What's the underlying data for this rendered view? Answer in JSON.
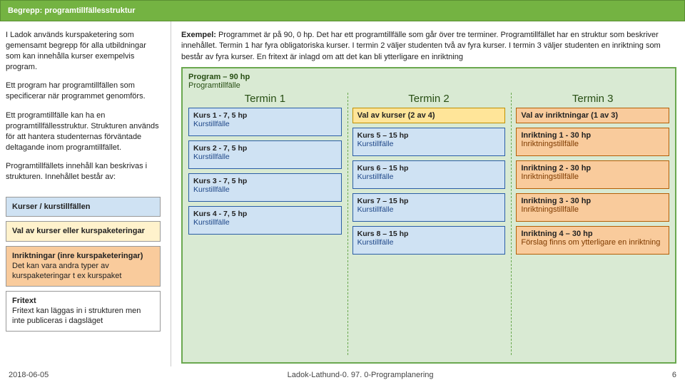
{
  "title": "Begrepp: programtillfällesstruktur",
  "left": {
    "p1": "I Ladok används kurspaketering som gemensamt begrepp för alla utbildningar som kan innehålla kurser exempelvis program.",
    "p2": "Ett program har programtillfällen som specificerar när programmet genomförs.",
    "p3": "Ett programtillfälle kan ha en programtillfällesstruktur. Strukturen används för att hantera studenternas förväntade deltagande inom programtillfället.",
    "p4": "Programtillfällets innehåll kan beskrivas i strukturen. Innehållet består av:",
    "box1": "Kurser / kurstillfällen",
    "box2": "Val av kurser eller kurspaketeringar",
    "box3a": "Inriktningar (inre kurspaketeringar)",
    "box3b": "Det kan vara andra typer av kurspaketeringar t ex kurspaket",
    "box4a": "Fritext",
    "box4b": "Fritext kan läggas in i strukturen men inte publiceras i dagsläget"
  },
  "exempel_label": "Exempel: ",
  "exempel": "Programmet är på 90, 0 hp. Det har ett programtillfälle som går över tre terminer. Programtillfället har en struktur som beskriver innehållet. Termin 1 har fyra obligatoriska kurser. I termin 2 väljer studenten två av fyra kurser. I termin 3 väljer studenten en inriktning som består av fyra kurser. En fritext är inlagd om att det kan bli ytterligare en inriktning",
  "program": {
    "title": "Program – 90 hp",
    "sub": "Programtillfälle"
  },
  "t1": {
    "head": "Termin 1",
    "c1": {
      "t": "Kurs 1 - 7, 5 hp",
      "s": "Kurstillfälle"
    },
    "c2": {
      "t": "Kurs 2 - 7, 5 hp",
      "s": "Kurstillfälle"
    },
    "c3": {
      "t": "Kurs 3 - 7, 5 hp",
      "s": "Kurstillfälle"
    },
    "c4": {
      "t": "Kurs 4 - 7, 5 hp",
      "s": "Kurstillfälle"
    }
  },
  "t2": {
    "head": "Termin 2",
    "sel": "Val av kurser (2 av 4)",
    "c1": {
      "t": "Kurs 5 – 15 hp",
      "s": "Kurstillfälle"
    },
    "c2": {
      "t": "Kurs 6 – 15 hp",
      "s": "Kurstillfälle"
    },
    "c3": {
      "t": "Kurs 7 – 15 hp",
      "s": "Kurstillfälle"
    },
    "c4": {
      "t": "Kurs 8 – 15 hp",
      "s": "Kurstillfälle"
    }
  },
  "t3": {
    "head": "Termin 3",
    "sel": "Val av inriktningar (1 av 3)",
    "c1": {
      "t": "Inriktning 1  - 30 hp",
      "s": "Inriktningstillfälle"
    },
    "c2": {
      "t": "Inriktning 2  - 30 hp",
      "s": "Inriktningstillfälle"
    },
    "c3": {
      "t": "Inriktning 3  - 30 hp",
      "s": "Inriktningstillfälle"
    },
    "c4": {
      "t": "Inriktning 4 – 30 hp",
      "s": "Förslag finns om ytterligare en inriktning"
    }
  },
  "footer": {
    "date": "2018-06-05",
    "center": "Ladok-Lathund-0. 97. 0-Programplanering",
    "page": "6"
  }
}
